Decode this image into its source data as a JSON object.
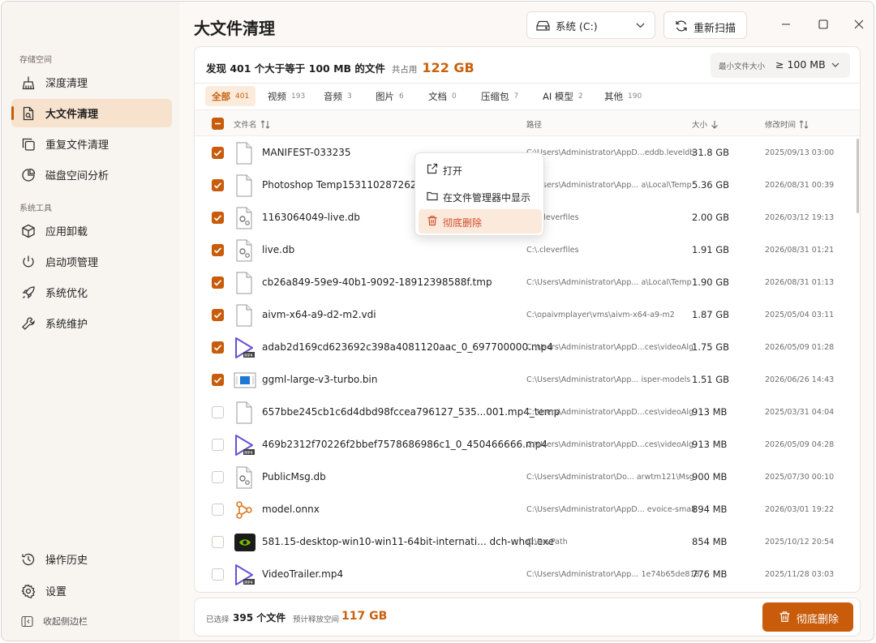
{
  "sidebar": {
    "section_storage": "存储空间",
    "section_tools": "系统工具",
    "items": [
      {
        "label": "深度清理"
      },
      {
        "label": "大文件清理"
      },
      {
        "label": "重复文件清理"
      },
      {
        "label": "磁盘空间分析"
      },
      {
        "label": "应用卸载"
      },
      {
        "label": "启动项管理"
      },
      {
        "label": "系统优化"
      },
      {
        "label": "系统维护"
      }
    ],
    "history": "操作历史",
    "settings": "设置",
    "collapse": "收起侧边栏"
  },
  "header": {
    "title": "大文件清理",
    "drive": "系统 (C:)",
    "rescan": "重新扫描"
  },
  "summary": {
    "found": "发现 401 个大于等于 100 MB 的文件",
    "total_label": "共占用",
    "total_value": "122 GB",
    "min_label": "最小文件大小",
    "min_value": "≥ 100 MB"
  },
  "tabs": [
    {
      "label": "全部",
      "count": "401"
    },
    {
      "label": "视频",
      "count": "193"
    },
    {
      "label": "音频",
      "count": "3"
    },
    {
      "label": "图片",
      "count": "6"
    },
    {
      "label": "文档",
      "count": "0"
    },
    {
      "label": "压缩包",
      "count": "7"
    },
    {
      "label": "AI 模型",
      "count": "2"
    },
    {
      "label": "其他",
      "count": "190"
    }
  ],
  "columns": {
    "name": "文件名",
    "path": "路径",
    "size": "大小",
    "modified": "修改时间"
  },
  "rows": [
    {
      "name": "MANIFEST-033235",
      "path": "C:\\Users\\Administrator\\AppD...eddb.leveldb",
      "size": "31.8 GB",
      "date": "2025/09/13 03:00",
      "checked": true,
      "icon": "file-icon"
    },
    {
      "name": "Photoshop Temp1531102872624",
      "path": "C:\\Users\\Administrator\\App... a\\Local\\Temp",
      "size": "5.36 GB",
      "date": "2026/08/31 00:39",
      "checked": true,
      "icon": "file-icon"
    },
    {
      "name": "1163064049-live.db",
      "path": "C:\\.cleverfiles",
      "size": "2.00 GB",
      "date": "2026/03/12 19:13",
      "checked": true,
      "icon": "db-file-icon"
    },
    {
      "name": "live.db",
      "path": "C:\\.cleverfiles",
      "size": "1.91 GB",
      "date": "2026/08/31 01:21",
      "checked": true,
      "icon": "db-file-icon"
    },
    {
      "name": "cb26a849-59e9-40b1-9092-18912398588f.tmp",
      "path": "C:\\Users\\Administrator\\App... a\\Local\\Temp",
      "size": "1.90 GB",
      "date": "2026/08/31 01:13",
      "checked": true,
      "icon": "file-icon"
    },
    {
      "name": "aivm-x64-a9-d2-m2.vdi",
      "path": "C:\\opaivmplayer\\vms\\aivm-x64-a9-m2",
      "size": "1.87 GB",
      "date": "2025/05/04 03:11",
      "checked": true,
      "icon": "file-icon"
    },
    {
      "name": "adab2d169cd623692c398a4081120aac_0_697700000.mp4",
      "path": "C:\\Users\\Administrator\\AppD...ces\\videoAlg",
      "size": "1.75 GB",
      "date": "2026/05/09 01:28",
      "checked": true,
      "icon": "mp4-icon"
    },
    {
      "name": "ggml-large-v3-turbo.bin",
      "path": "C:\\Users\\Administrator\\App... isper-models",
      "size": "1.51 GB",
      "date": "2026/06/26 14:43",
      "checked": true,
      "icon": "bin-file-icon"
    },
    {
      "name": "657bbe245cb1c6d4dbd98fccea796127_535...001.mp4_temp",
      "path": "C:\\Users\\Administrator\\AppD...ces\\videoAlg",
      "size": "913 MB",
      "date": "2025/03/31 04:04",
      "checked": false,
      "icon": "file-icon"
    },
    {
      "name": "469b2312f70226f2bbef7578686986c1_0_450466666.mp4",
      "path": "C:\\Users\\Administrator\\AppD...ces\\videoAlg",
      "size": "913 MB",
      "date": "2026/05/09 04:28",
      "checked": false,
      "icon": "mp4-icon"
    },
    {
      "name": "PublicMsg.db",
      "path": "C:\\Users\\Administrator\\Do... arwtm121\\Msg",
      "size": "900 MB",
      "date": "2025/07/30 00:10",
      "checked": false,
      "icon": "db-file-icon"
    },
    {
      "name": "model.onnx",
      "path": "C:\\Users\\Administrator\\AppD... evoice-small",
      "size": "894 MB",
      "date": "2026/03/01 19:22",
      "checked": false,
      "icon": "onnx-icon"
    },
    {
      "name": "581.15-desktop-win10-win11-64bit-internati... dch-whql.exe",
      "path": "C:\\DrvPath",
      "size": "854 MB",
      "date": "2025/10/12 20:54",
      "checked": false,
      "icon": "nvidia-exe-icon"
    },
    {
      "name": "VideoTrailer.mp4",
      "path": "C:\\Users\\Administrator\\App... 1e74b65de818",
      "size": "776 MB",
      "date": "2025/11/28 03:03",
      "checked": false,
      "icon": "mp4-icon"
    }
  ],
  "context_menu": {
    "open": "打开",
    "show_in_explorer": "在文件管理器中显示",
    "delete": "彻底删除"
  },
  "footer": {
    "selected_label": "已选择",
    "selected_value": "395 个文件",
    "free_label": "预计释放空间",
    "free_value": "117 GB",
    "delete_button": "彻底删除"
  },
  "colors": {
    "accent": "#c85c0a",
    "accent_light": "#f7e2cd",
    "danger_text": "#d14b2a"
  }
}
